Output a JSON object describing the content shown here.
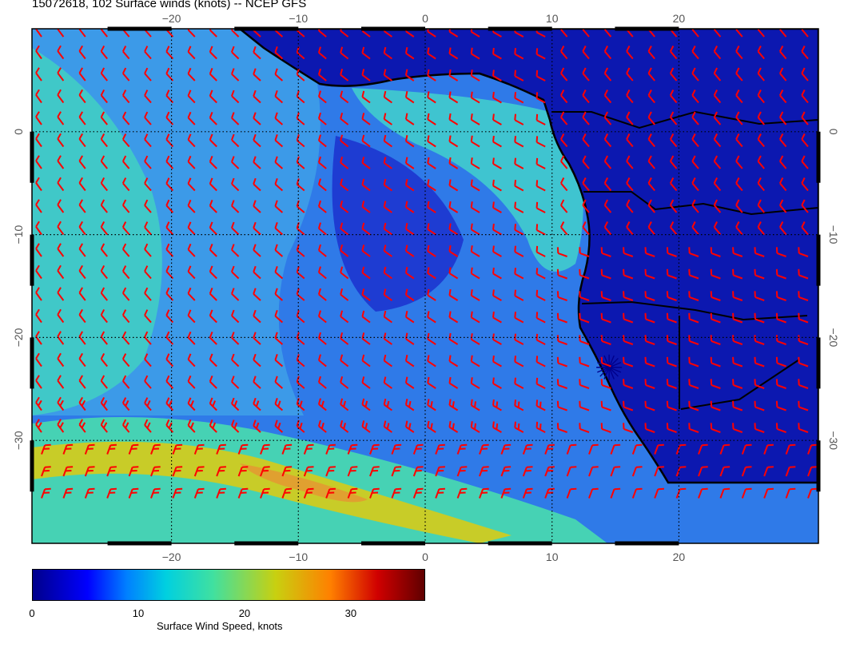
{
  "title": "15072618, 102 Surface winds (knots) -- NCEP GFS",
  "map": {
    "lon_range": [
      -31,
      31
    ],
    "lat_range": [
      -40,
      10
    ],
    "lon_tick_values": [
      -20,
      -10,
      0,
      10,
      20
    ],
    "lat_tick_values": [
      0,
      -10,
      -20,
      -30
    ],
    "lon_tick_labels": [
      "−20",
      "−10",
      "0",
      "10",
      "20"
    ],
    "lat_tick_labels": [
      "0",
      "−10",
      "−20",
      "−30"
    ],
    "colors": {
      "calm": "#1428c8",
      "light": "#2f7ae8",
      "moderate": "#30b8e0",
      "fresh": "#46d2b4",
      "strong": "#c8cc28",
      "land": "#0c18b0",
      "barb": "#ff0000",
      "coast": "#000000"
    },
    "marked_location": {
      "lon": 14.5,
      "lat": -22.9
    }
  },
  "colorbar": {
    "range": [
      0,
      37
    ],
    "tick_values": [
      0,
      10,
      20,
      30
    ],
    "tick_labels": [
      "0",
      "10",
      "20",
      "30"
    ],
    "label": "Surface Wind Speed, knots"
  }
}
